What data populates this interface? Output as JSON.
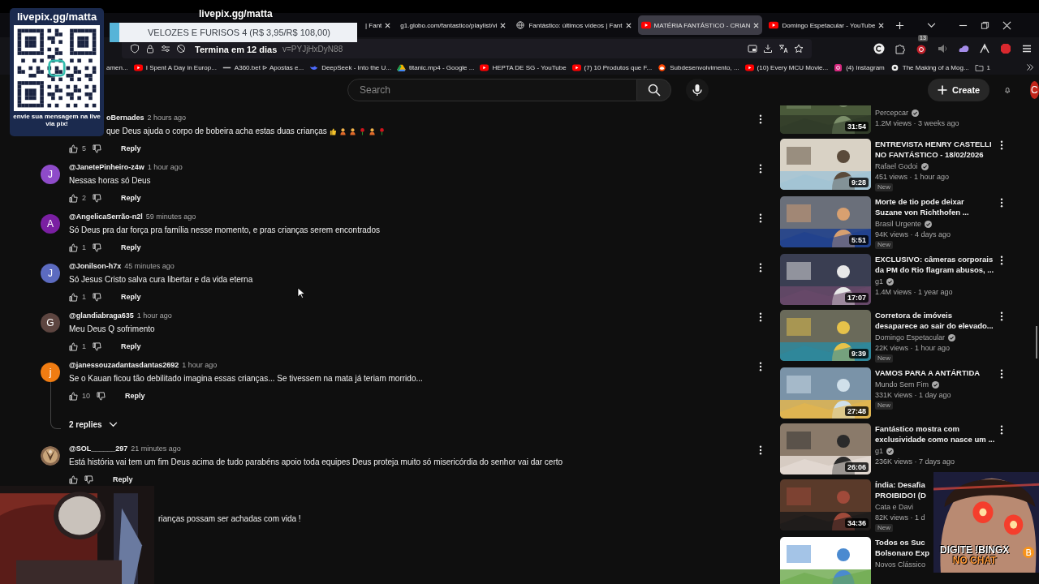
{
  "stream_overlay": {
    "livepix": {
      "url": "livepix.gg/matta",
      "message": "envie sua mensagem na live via pix!"
    },
    "caption": "livepix.gg/matta",
    "goal": {
      "title": "VELOZES E FURISOS 4 (R$ 3,95/R$ 108,00)",
      "level": 0.04,
      "deadline": "Termina em 12 dias"
    },
    "promo": {
      "line_1": "DIGITE !BINGX",
      "line_2": "NO CHAT"
    }
  },
  "browser": {
    "tabs": [
      {
        "title": "| Fant",
        "selected": false
      },
      {
        "title": "g1.globo.com/fantastico/playlist/vi",
        "selected": false
      },
      {
        "title": "Fantástico: últimos vídeos | Fant",
        "selected": false
      },
      {
        "title": "MATÉRIA FANTÁSTICO - CRIAN",
        "selected": true
      },
      {
        "title": "Domingo Espetacular - YouTube",
        "selected": false
      }
    ],
    "url": "v=PYJjHxDyN88",
    "extension_badge": "13",
    "bookmarks": [
      "amen...",
      "I Spent A Day in Europ...",
      "A360.bet ⊳ Apostas e...",
      "DeepSeek - Into the U...",
      "titanic.mp4 - Google ...",
      "HEPTA DE SG - YouTube",
      "(7) 10 Produtos que F...",
      "Subdesenvolvimento, ...",
      "(10) Every MCU Movie...",
      "(4) Instagram",
      "The Making of a Mog...",
      "1"
    ]
  },
  "youtube": {
    "search": {
      "placeholder": "Search"
    },
    "create": "Create",
    "account": "C",
    "comments": [
      {
        "kind": "under_panel",
        "author": "oBernades",
        "time": "2 hours ago",
        "text": "que Deus ajuda o corpo de bobeira acha estas duas crianças",
        "likes": "5",
        "reply": "Reply"
      },
      {
        "kind": "normal",
        "avatar": "J",
        "color": "#8e4bc9",
        "author": "@JanetePinheiro-z4w",
        "time": "1 hour ago",
        "text": "Nessas horas só Deus",
        "likes": "2",
        "reply": "Reply"
      },
      {
        "kind": "normal",
        "avatar": "A",
        "color": "#7a1fa2",
        "author": "@AngelicaSerrão-n2l",
        "time": "59 minutes ago",
        "text": "Só Deus pra dar força pra família nesse momento, e pras crianças serem encontrados",
        "likes": "1",
        "reply": "Reply"
      },
      {
        "kind": "normal",
        "avatar": "J",
        "color": "#5c6bc0",
        "author": "@Jonilson-h7x",
        "time": "45 minutes ago",
        "text": "Só Jesus Cristo salva cura libertar e da vida eterna",
        "likes": "1",
        "reply": "Reply"
      },
      {
        "kind": "normal",
        "avatar": "G",
        "color": "#5d4540",
        "author": "@glandiabraga635",
        "time": "1 hour ago",
        "text": "Meu Deus Q sofrimento",
        "likes": "1",
        "reply": "Reply"
      },
      {
        "kind": "normal",
        "avatar": "j",
        "color": "#f07c12",
        "author": "@janessouzadantasdantas2692",
        "time": "1 hour ago",
        "text": "Se o Kauan ficou tão debilitado imagina essas crianças... Se tivessem na mata já teriam morrido...",
        "likes": "10",
        "reply": "Reply",
        "replies": "2 replies"
      },
      {
        "kind": "normal",
        "author": "@SOL______297",
        "time": "21 minutes ago",
        "text": "Está história vai tem um fim Deus acima de tudo parabéns apoio toda equipes Deus proteja muito só misericórdia do senhor vai dar certo",
        "reply": "Reply"
      },
      {
        "kind": "under_webcam",
        "text": "rianças possam ser achadas com vida !"
      }
    ],
    "related": [
      {
        "kind": "cut",
        "duration": "31:54",
        "channel": "Percepcar",
        "verified": true,
        "meta": "1.2M views · 3 weeks ago",
        "menu": false
      },
      {
        "kind": "full",
        "title": [
          "ENTREVISTA HENRY CASTELLI",
          "NO FANTÁSTICO - 18/02/2026"
        ],
        "duration": "9:28",
        "channel": "Rafael Godoi",
        "verified": true,
        "meta": "451 views · 1 hour ago",
        "badge": "New",
        "menu": true
      },
      {
        "kind": "full",
        "title": [
          "Morte de tio pode deixar",
          "Suzane von Richthofen ..."
        ],
        "duration": "5:51",
        "channel": "Brasil Urgente",
        "verified": true,
        "meta": "94K views · 4 days ago",
        "badge": "New",
        "menu": true
      },
      {
        "kind": "full",
        "title": [
          "EXCLUSIVO: câmeras corporais",
          "da PM do Rio flagram abusos, ..."
        ],
        "duration": "17:07",
        "channel": "g1",
        "verified": true,
        "meta": "1.4M views · 1 year ago",
        "menu": true
      },
      {
        "kind": "full",
        "title": [
          "Corretora de imóveis",
          "desaparece ao sair do elevado..."
        ],
        "duration": "9:39",
        "channel": "Domingo Espetacular",
        "verified": true,
        "meta": "22K views · 1 hour ago",
        "badge": "New",
        "menu": true
      },
      {
        "kind": "full",
        "title": [
          "VAMOS PARA A ANTÁRTIDA"
        ],
        "duration": "27:48",
        "channel": "Mundo Sem Fim",
        "verified": true,
        "meta": "331K views · 1 day ago",
        "badge": "New",
        "menu": true
      },
      {
        "kind": "full",
        "title": [
          "Fantástico mostra com",
          "exclusividade como nasce um ..."
        ],
        "duration": "26:06",
        "channel": "g1",
        "verified": true,
        "meta": "236K views · 7 days ago",
        "menu": true
      },
      {
        "kind": "full",
        "title": [
          "Índia: Desafia",
          "PROIBIDO! (D"
        ],
        "duration": "34:36",
        "channel": "Cata e Davi",
        "meta": "82K views · 1 d",
        "badge": "New"
      },
      {
        "kind": "full",
        "title": [
          "Todos os Suc",
          "Bolsonaro Exp"
        ],
        "channel": "Novos Clássico"
      }
    ]
  }
}
